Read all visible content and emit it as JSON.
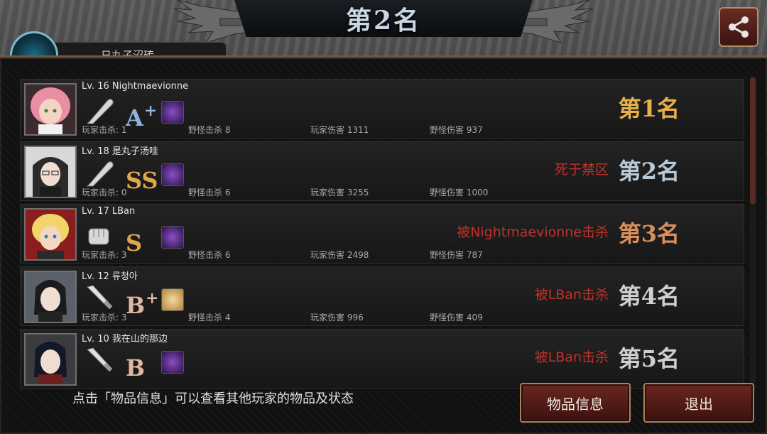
{
  "header": {
    "title": "第2名",
    "left_tab_text": "日丸子沼砖"
  },
  "colors": {
    "rank_gold": "#e8b04a",
    "rank_silver": "#b9c9d8",
    "rank_bronze": "#d78f5c",
    "rank_gray": "#cfcfcf",
    "death_red": "#c3302a"
  },
  "players": [
    {
      "level_name": "Lv. 16 Nightmaevionne",
      "weapon_icon": "bat-icon",
      "grade": "A",
      "grade_plus": "+",
      "grade_color": "#8fb3e0",
      "item_icon": "purple-item-icon",
      "death": "",
      "rank": "第1名",
      "rank_color": "#e8b04a",
      "stats": {
        "player_kills": "玩家击杀: 1",
        "monster_kills": "野怪击杀 8",
        "player_damage": "玩家伤害 1311",
        "monster_damage": "野怪伤害 937"
      }
    },
    {
      "level_name": "Lv. 18 是丸子汤哇",
      "weapon_icon": "bat-icon",
      "grade": "SS",
      "grade_plus": "",
      "grade_color": "#e3a54c",
      "item_icon": "purple-item-icon",
      "death": "死于禁区",
      "rank": "第2名",
      "rank_color": "#b9c9d8",
      "stats": {
        "player_kills": "玩家击杀: 0",
        "monster_kills": "野怪击杀 6",
        "player_damage": "玩家伤害 3255",
        "monster_damage": "野怪伤害 1000"
      }
    },
    {
      "level_name": "Lv. 17 LBan",
      "weapon_icon": "fist-icon",
      "grade": "S",
      "grade_plus": "",
      "grade_color": "#e3a54c",
      "item_icon": "purple-item-icon",
      "death": "被Nightmaevionne击杀",
      "rank": "第3名",
      "rank_color": "#d78f5c",
      "stats": {
        "player_kills": "玩家击杀: 3",
        "monster_kills": "野怪击杀 6",
        "player_damage": "玩家伤害 2498",
        "monster_damage": "野怪伤害 787"
      }
    },
    {
      "level_name": "Lv. 12 류청아",
      "weapon_icon": "knife-icon",
      "grade": "B",
      "grade_plus": "+",
      "grade_color": "#e0b7a0",
      "item_icon": "gold-item-icon",
      "death": "被LBan击杀",
      "rank": "第4名",
      "rank_color": "#cfcfcf",
      "stats": {
        "player_kills": "玩家击杀: 3",
        "monster_kills": "野怪击杀 4",
        "player_damage": "玩家伤害 996",
        "monster_damage": "野怪伤害 409"
      }
    },
    {
      "level_name": "Lv. 10 我在山的那边",
      "weapon_icon": "knife-icon",
      "grade": "B",
      "grade_plus": "",
      "grade_color": "#e0b7a0",
      "item_icon": "purple-item-icon",
      "death": "被LBan击杀",
      "rank": "第5名",
      "rank_color": "#cfcfcf",
      "stats": {
        "player_kills": "",
        "monster_kills": "",
        "player_damage": "",
        "monster_damage": ""
      }
    }
  ],
  "footer": {
    "note": "点击「物品信息」可以查看其他玩家的物品及状态",
    "items_button": "物品信息",
    "exit_button": "退出"
  }
}
